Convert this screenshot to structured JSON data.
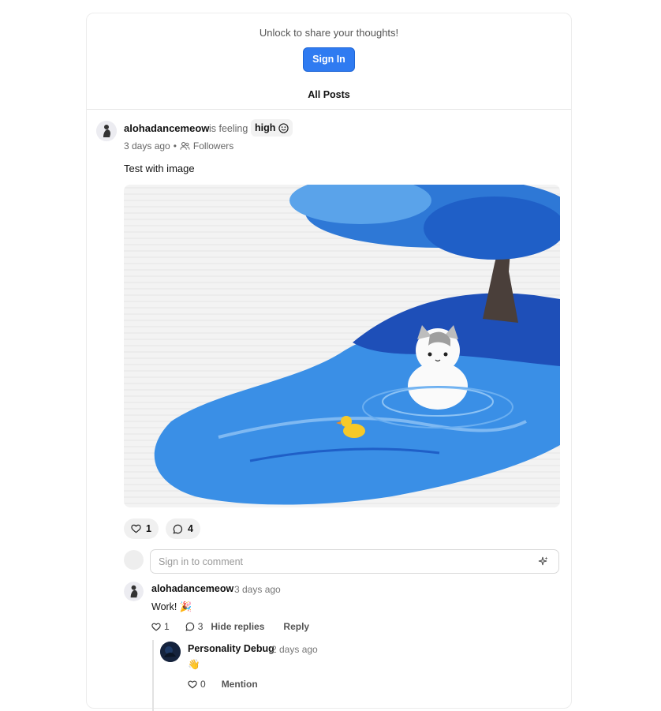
{
  "header": {
    "unlock_text": "Unlock to share your thoughts!",
    "signin_label": "Sign In",
    "tab_label": "All Posts"
  },
  "post": {
    "author": "alohadancemeow",
    "feeling_prefix": "is feeling",
    "mood": "high",
    "time_ago": "3 days ago",
    "separator": "•",
    "audience": "Followers",
    "text": "Test with image",
    "likes": "1",
    "comments": "4",
    "comment_placeholder": "Sign in to comment"
  },
  "comments": [
    {
      "author": "alohadancemeow",
      "time_ago": "3 days ago",
      "text": "Work! 🎉",
      "likes": "1",
      "replies_count": "3",
      "hide_replies_label": "Hide replies",
      "reply_label": "Reply",
      "replies": [
        {
          "author": "Personality Debug",
          "time_ago": "2 days ago",
          "text": "👋",
          "likes": "0",
          "mention_label": "Mention"
        }
      ]
    }
  ],
  "colors": {
    "accent": "#2f7bf1",
    "water": "#3a8fe6",
    "tree": "#1f5fc7"
  }
}
